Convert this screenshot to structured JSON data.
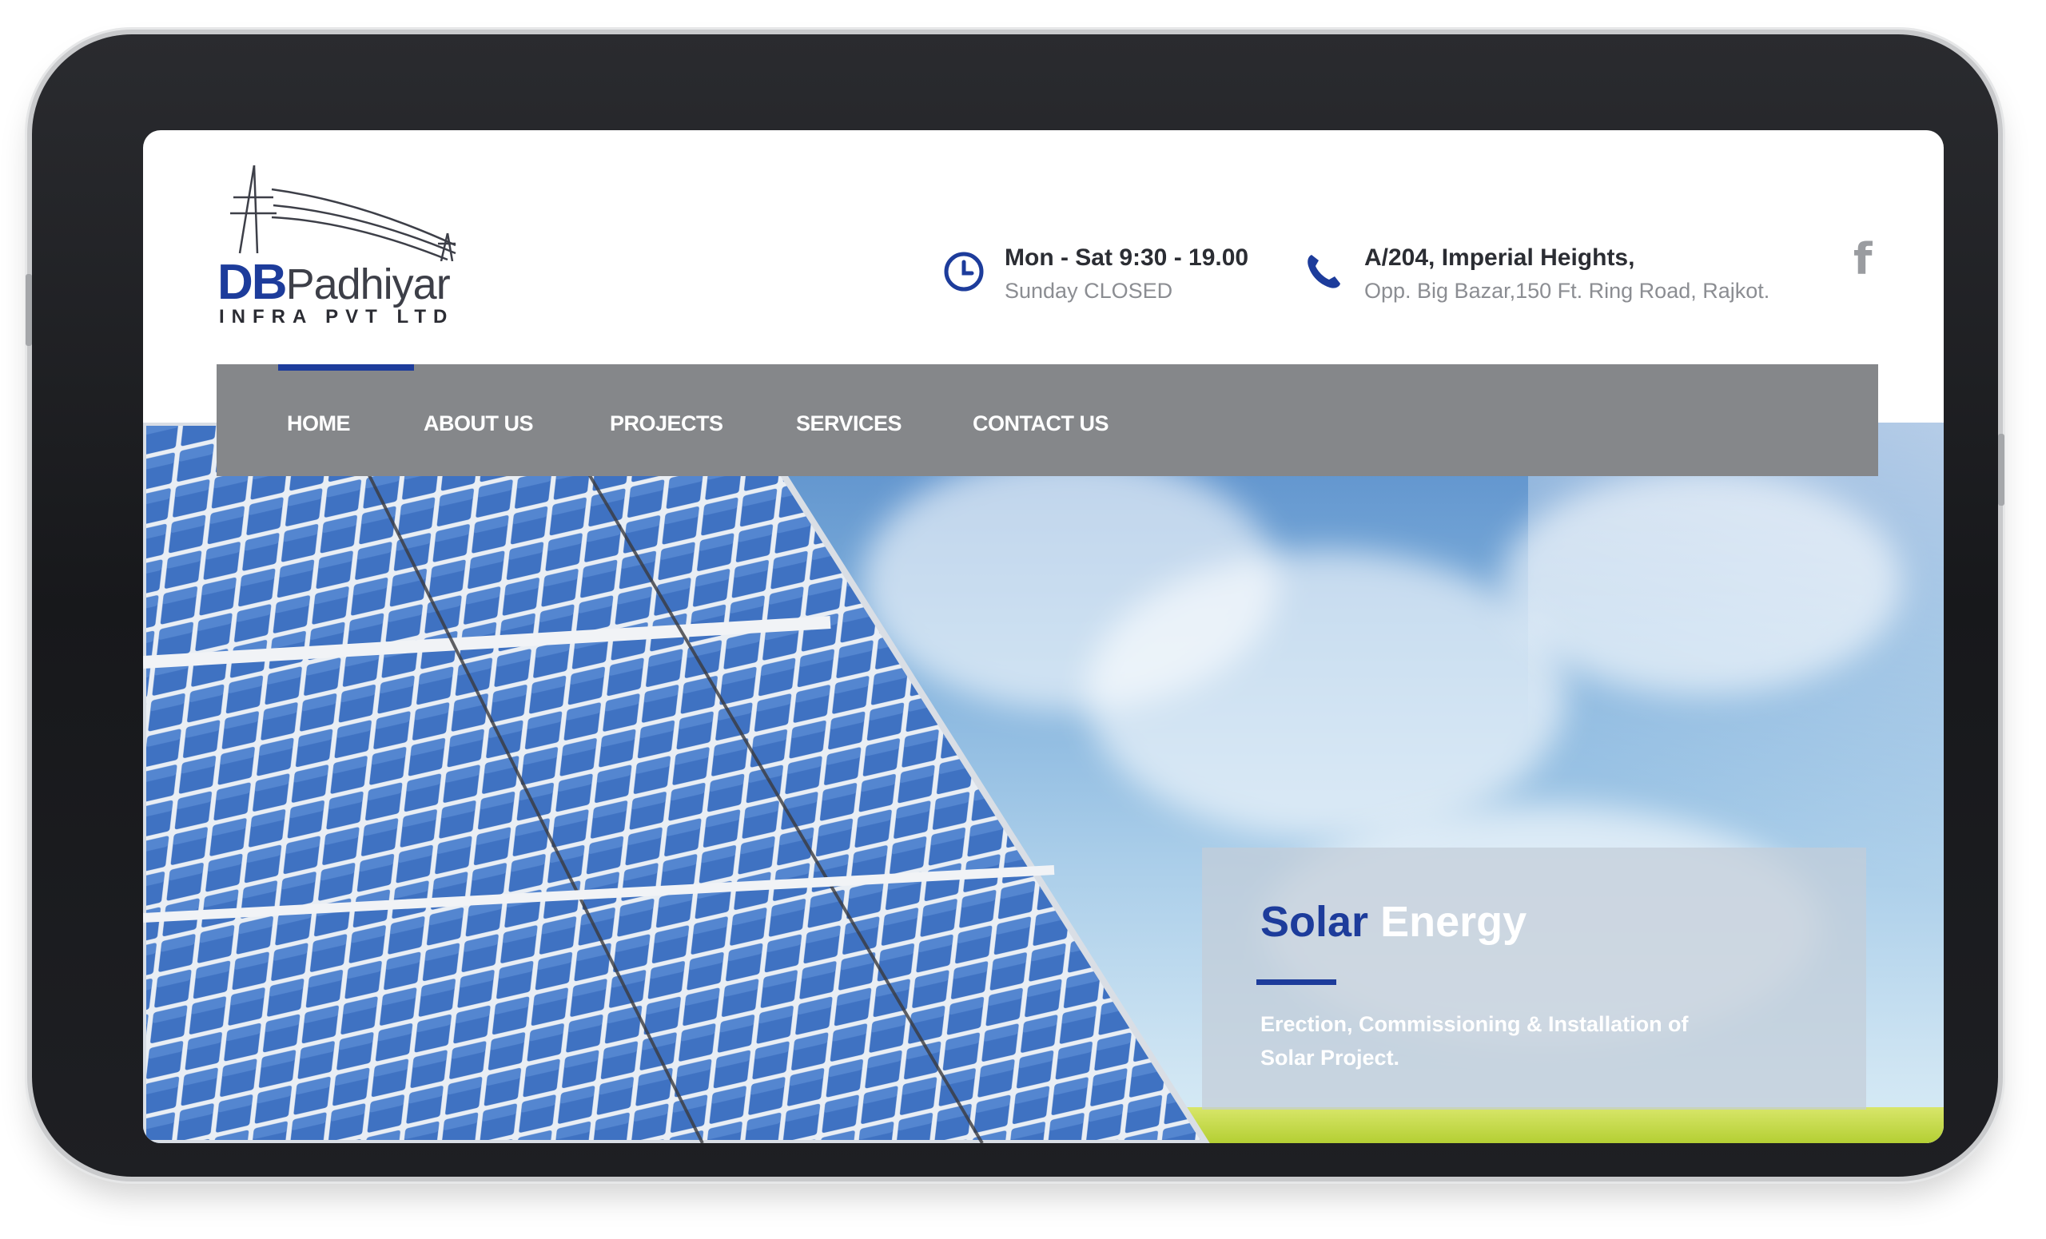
{
  "company": {
    "logo_db": "DB",
    "logo_name": "Padhiyar",
    "logo_sub": "INFRA PVT LTD"
  },
  "header": {
    "hours_title": "Mon - Sat 9:30 - 19.00",
    "hours_sub": "Sunday CLOSED",
    "address_title": "A/204, Imperial Heights,",
    "address_sub": "Opp. Big Bazar,150 Ft. Ring Road, Rajkot.",
    "social_icon": "facebook-icon",
    "social_glyph": "f"
  },
  "nav": {
    "items": [
      "HOME",
      "ABOUT US",
      "PROJECTS",
      "SERVICES",
      "CONTACT US"
    ],
    "active": "HOME"
  },
  "hero": {
    "title_part1": "Solar",
    "title_part2": "Energy",
    "description": "Erection, Commissioning & Installation of Solar Project."
  },
  "colors": {
    "brand_blue": "#1d3c9b",
    "nav_gray": "#85878a",
    "text_dark": "#2b2d33",
    "text_muted": "#8b8d92"
  }
}
